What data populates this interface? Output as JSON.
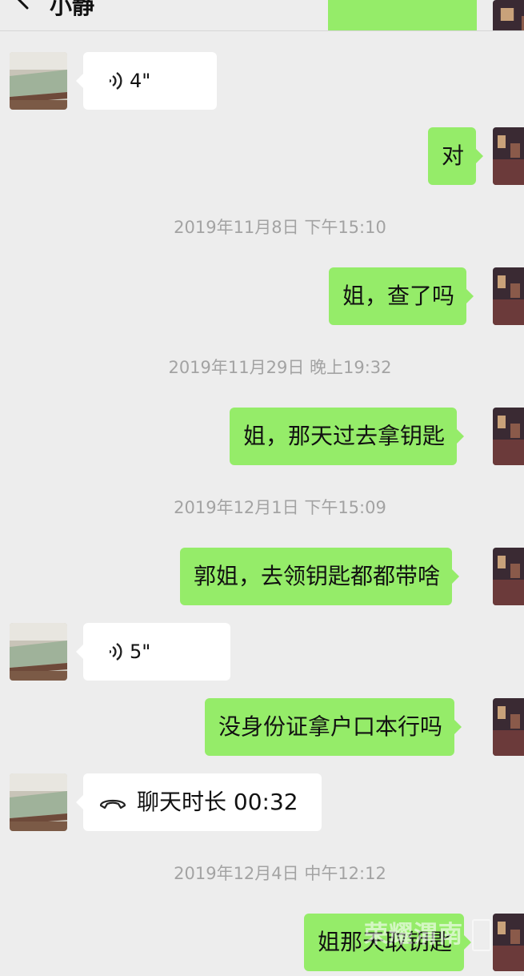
{
  "header": {
    "title": "小静"
  },
  "messages": [
    {
      "side": "in",
      "type": "voice",
      "duration": "4\""
    },
    {
      "side": "out",
      "text": "对"
    },
    {
      "timestamp": "2019年11月8日 下午15:10"
    },
    {
      "side": "out",
      "text": "姐，查了吗"
    },
    {
      "timestamp": "2019年11月29日 晚上19:32"
    },
    {
      "side": "out",
      "text": "姐，那天过去拿钥匙"
    },
    {
      "timestamp": "2019年12月1日 下午15:09"
    },
    {
      "side": "out",
      "text": "郭姐，去领钥匙都都带啥"
    },
    {
      "side": "in",
      "type": "voice",
      "duration": "5\""
    },
    {
      "side": "out",
      "text": "没身份证拿户口本行吗"
    },
    {
      "side": "in",
      "type": "call",
      "text": "聊天时长 00:32"
    },
    {
      "timestamp": "2019年12月4日 中午12:12"
    },
    {
      "side": "out",
      "text": "姐那天取钥匙"
    }
  ],
  "watermark": "荣耀渭南",
  "colors": {
    "background": "#ededed",
    "outgoing_bubble": "#95ec69",
    "incoming_bubble": "#ffffff",
    "timestamp": "#a3a3a3"
  }
}
